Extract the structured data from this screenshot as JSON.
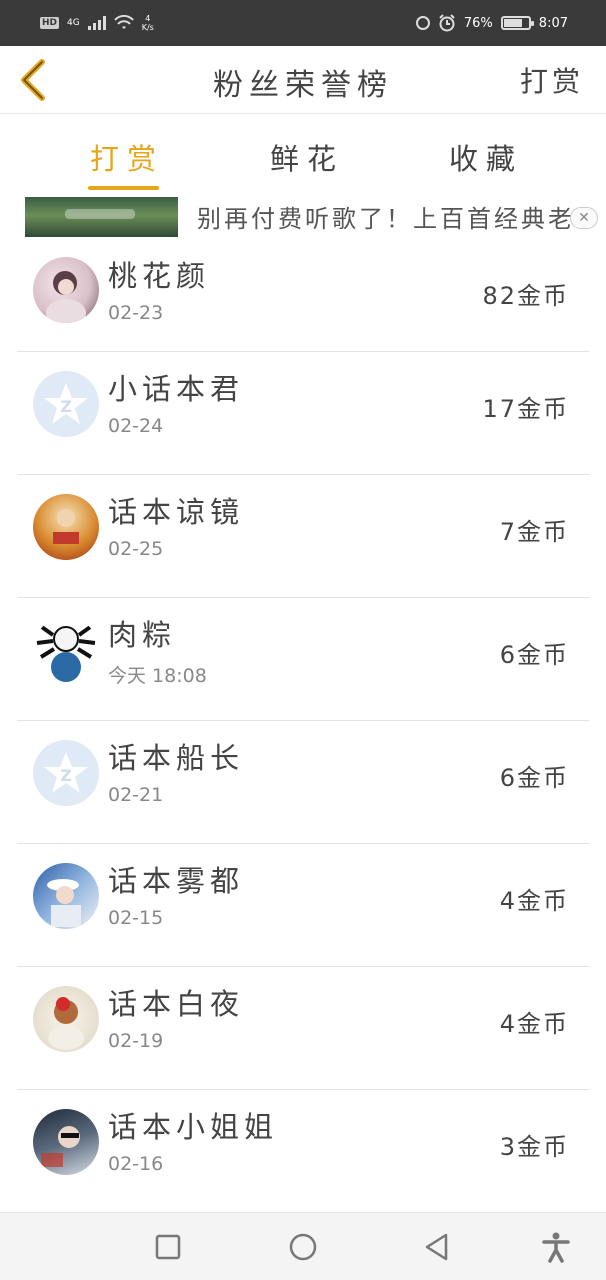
{
  "status_bar": {
    "hd": "HD",
    "network": "4G",
    "speed_value": "4",
    "speed_unit": "K/s",
    "battery": "76%",
    "time": "8:07",
    "battery_level": 0.76
  },
  "header": {
    "back_icon": "chevron-left-icon",
    "title": "粉丝荣誉榜",
    "action": "打赏"
  },
  "tabs": [
    {
      "label": "打赏",
      "active": true
    },
    {
      "label": "鲜花",
      "active": false
    },
    {
      "label": "收藏",
      "active": false
    }
  ],
  "ad": {
    "text": "别再付费听歌了！上百首经典老"
  },
  "ranking": [
    {
      "name": "桃花颜",
      "date": "02-23",
      "amount": "82金币",
      "avatar": "photo"
    },
    {
      "name": "小话本君",
      "date": "02-24",
      "amount": "17金币",
      "avatar": "default"
    },
    {
      "name": "话本谅镜",
      "date": "02-25",
      "amount": "7金币",
      "avatar": "photo"
    },
    {
      "name": "肉粽",
      "date": "今天 18:08",
      "amount": "6金币",
      "avatar": "photo"
    },
    {
      "name": "话本船长",
      "date": "02-21",
      "amount": "6金币",
      "avatar": "default"
    },
    {
      "name": "话本雾都",
      "date": "02-15",
      "amount": "4金币",
      "avatar": "photo"
    },
    {
      "name": "话本白夜",
      "date": "02-19",
      "amount": "4金币",
      "avatar": "photo"
    },
    {
      "name": "话本小姐姐",
      "date": "02-16",
      "amount": "3金币",
      "avatar": "photo"
    }
  ],
  "colors": {
    "accent": "#e8a51a",
    "status_bar": "#3a3a3a",
    "text": "#444444",
    "subtext": "#888888"
  },
  "navbar": [
    "square-icon",
    "circle-icon",
    "triangle-back-icon",
    "accessibility-icon"
  ]
}
